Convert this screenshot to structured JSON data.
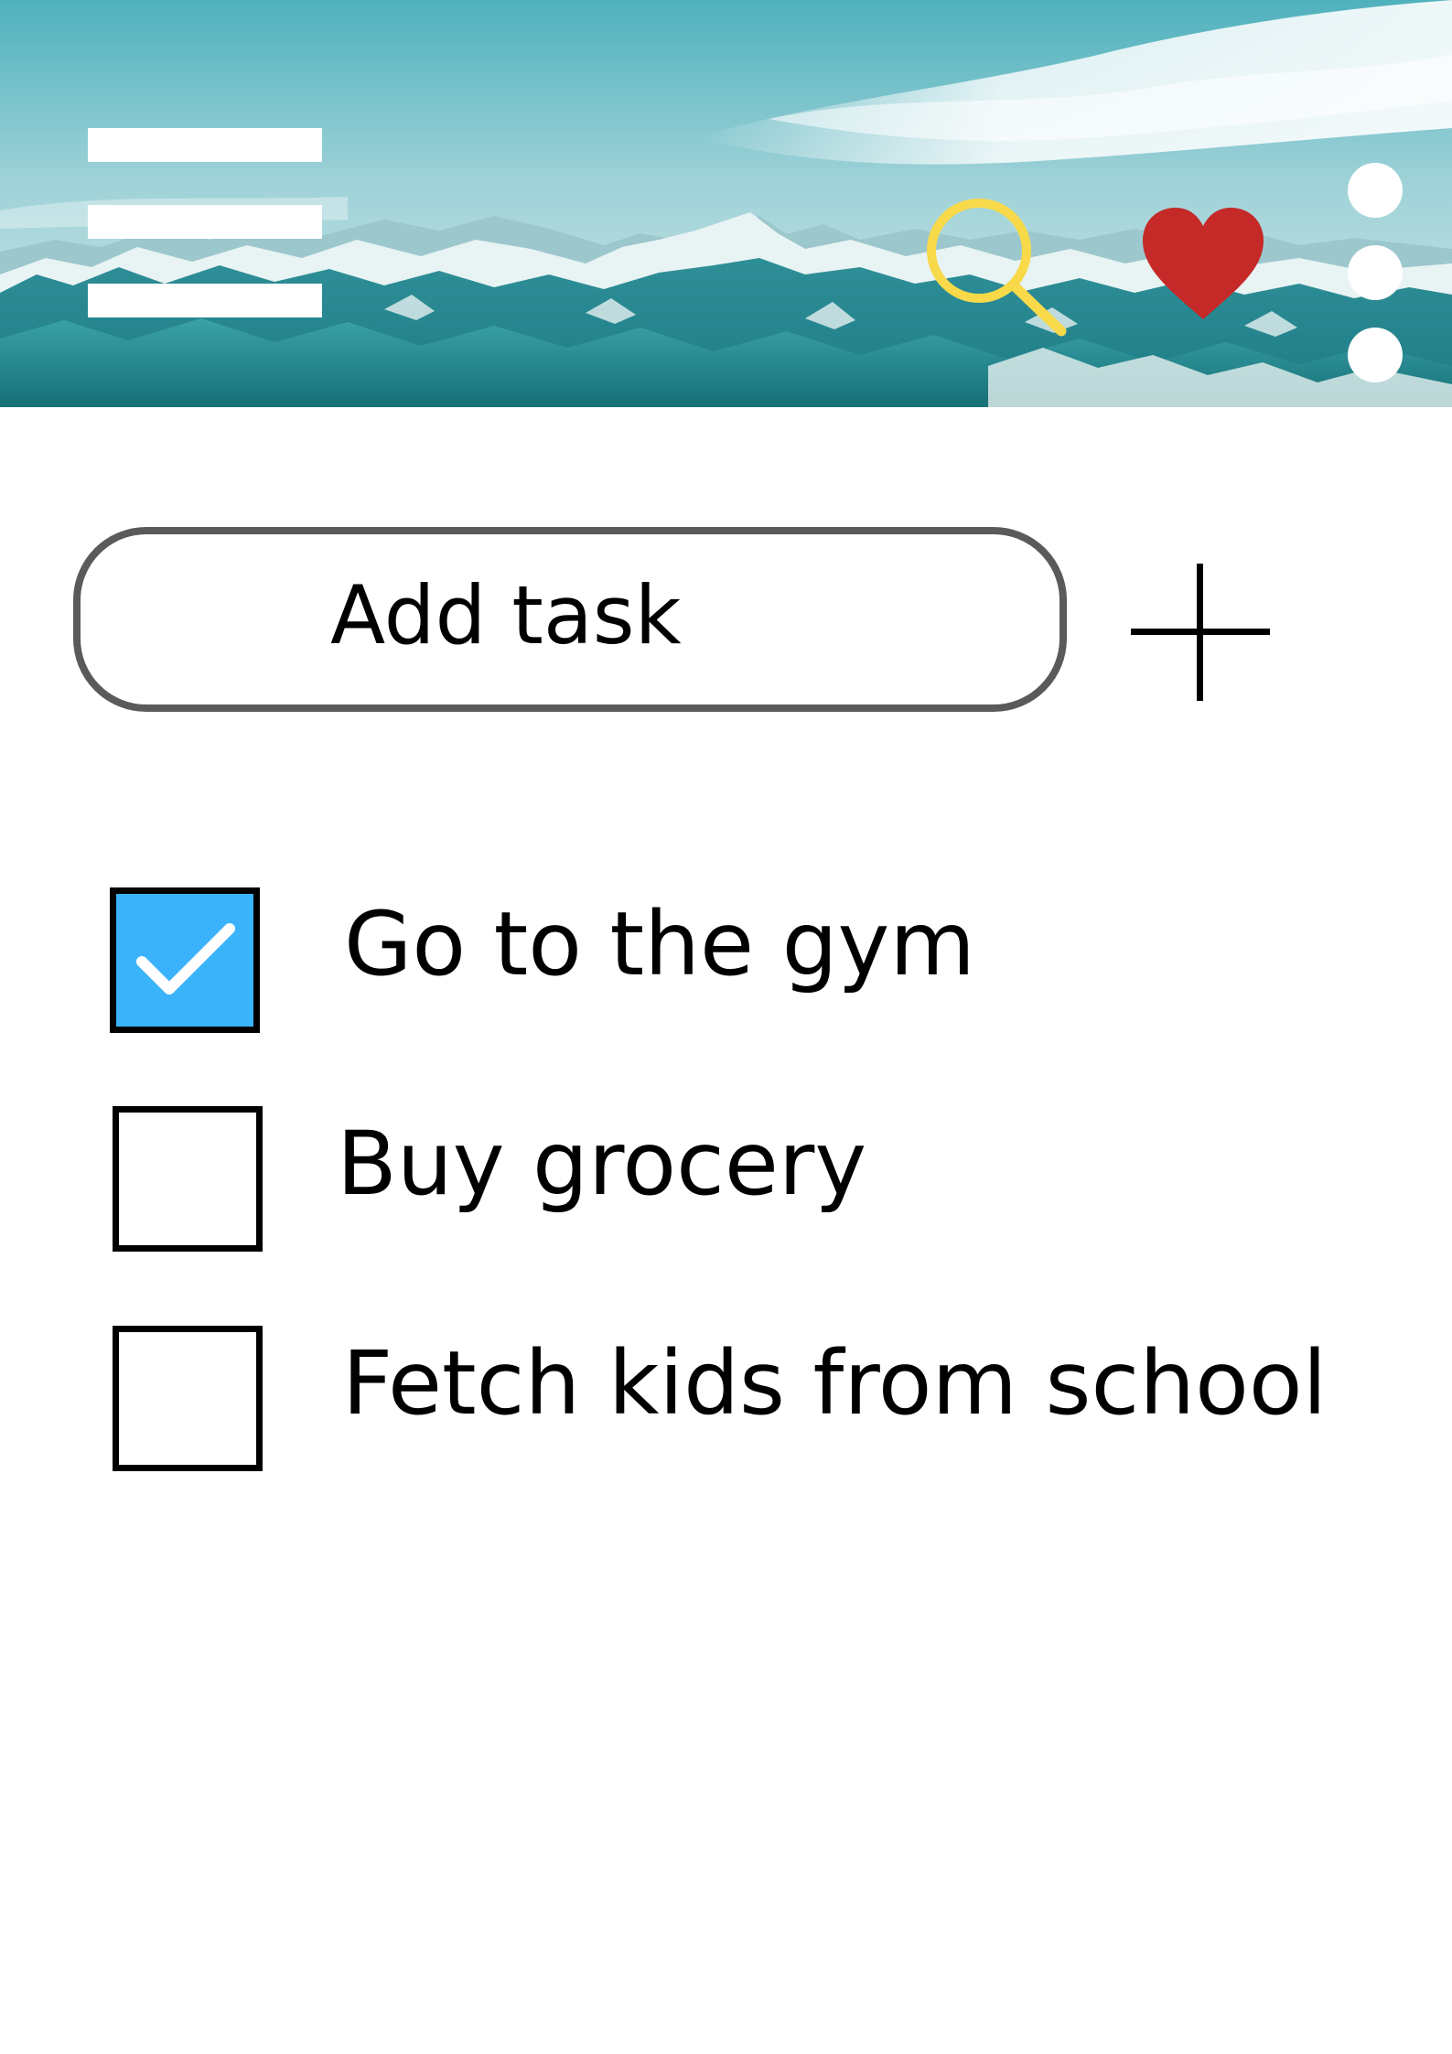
{
  "header": {
    "menu_icon": "hamburger-menu-icon",
    "search_icon": "search-icon",
    "favorite_icon": "heart-icon",
    "more_icon": "more-vertical-icon",
    "colors": {
      "search": "#f7d94a",
      "heart": "#c52a28",
      "menu": "#ffffff"
    }
  },
  "add_task": {
    "placeholder": "Add task",
    "add_icon": "plus-icon"
  },
  "tasks": [
    {
      "label": "Go to the gym",
      "checked": true
    },
    {
      "label": "Buy grocery",
      "checked": false
    },
    {
      "label": "Fetch kids from school",
      "checked": false
    }
  ],
  "colors": {
    "checkbox_checked": "#3bb3fb",
    "field_border": "#5a5a5a"
  }
}
